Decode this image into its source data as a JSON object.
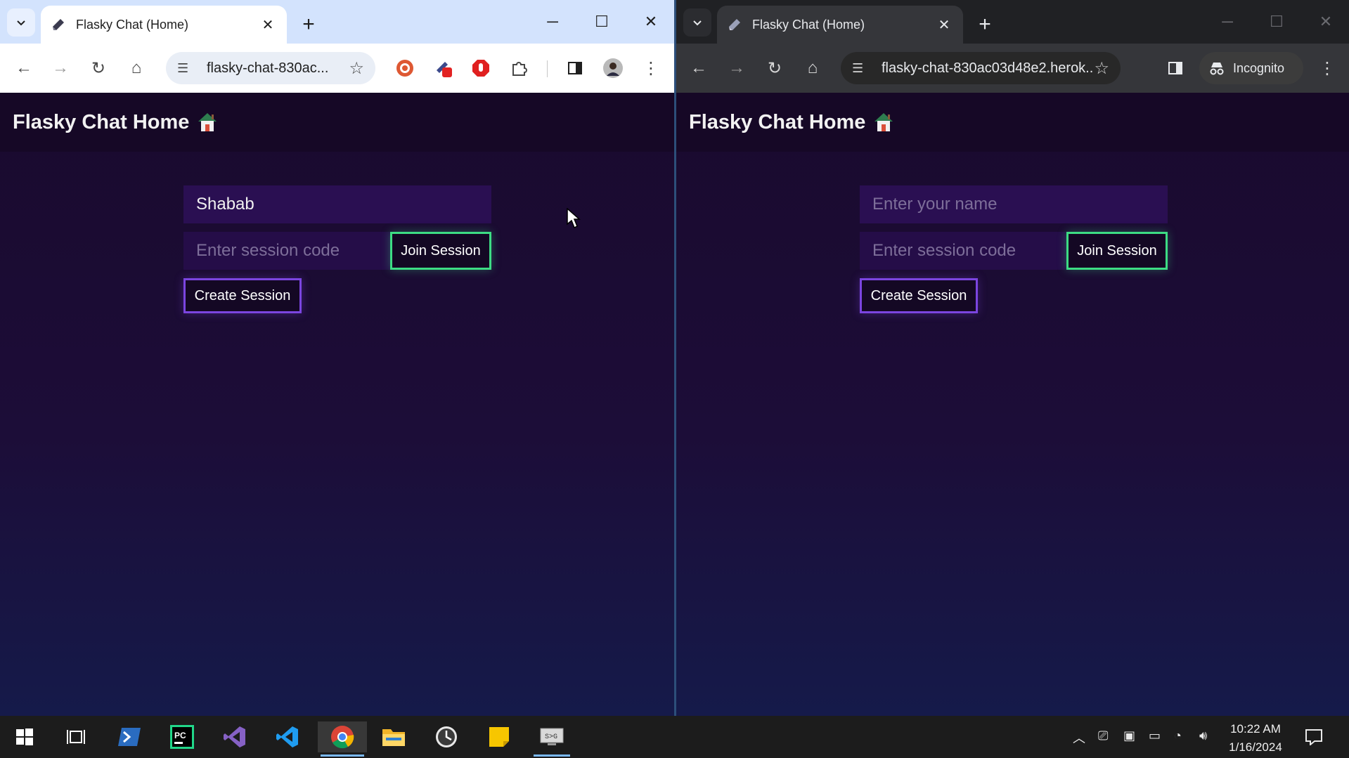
{
  "left_window": {
    "tab_title": "Flasky Chat (Home)",
    "url": "flasky-chat-830ac...",
    "page": {
      "brand": "Flasky Chat Home",
      "name_value": "Shabab",
      "name_placeholder": "Enter your name",
      "session_placeholder": "Enter session code",
      "join_label": "Join Session",
      "create_label": "Create Session"
    }
  },
  "right_window": {
    "tab_title": "Flasky Chat (Home)",
    "url": "flasky-chat-830ac03d48e2.herok...",
    "incognito_label": "Incognito",
    "page": {
      "brand": "Flasky Chat Home",
      "name_placeholder": "Enter your name",
      "session_placeholder": "Enter session code",
      "join_label": "Join Session",
      "create_label": "Create Session"
    }
  },
  "taskbar": {
    "time": "10:22 AM",
    "date": "1/16/2024",
    "pinned": [
      "windows-start-icon",
      "task-view-icon",
      "powershell-icon",
      "pycharm-icon",
      "visual-studio-icon",
      "vscode-icon",
      "chrome-icon",
      "file-explorer-icon",
      "clock-app-icon",
      "sticky-notes-icon",
      "remote-desktop-icon"
    ]
  },
  "colors": {
    "page_bg_top": "#1a0a2e",
    "join_border": "#3ddc84",
    "create_border": "#7b45e0",
    "input_bg": "#2a0f52"
  }
}
